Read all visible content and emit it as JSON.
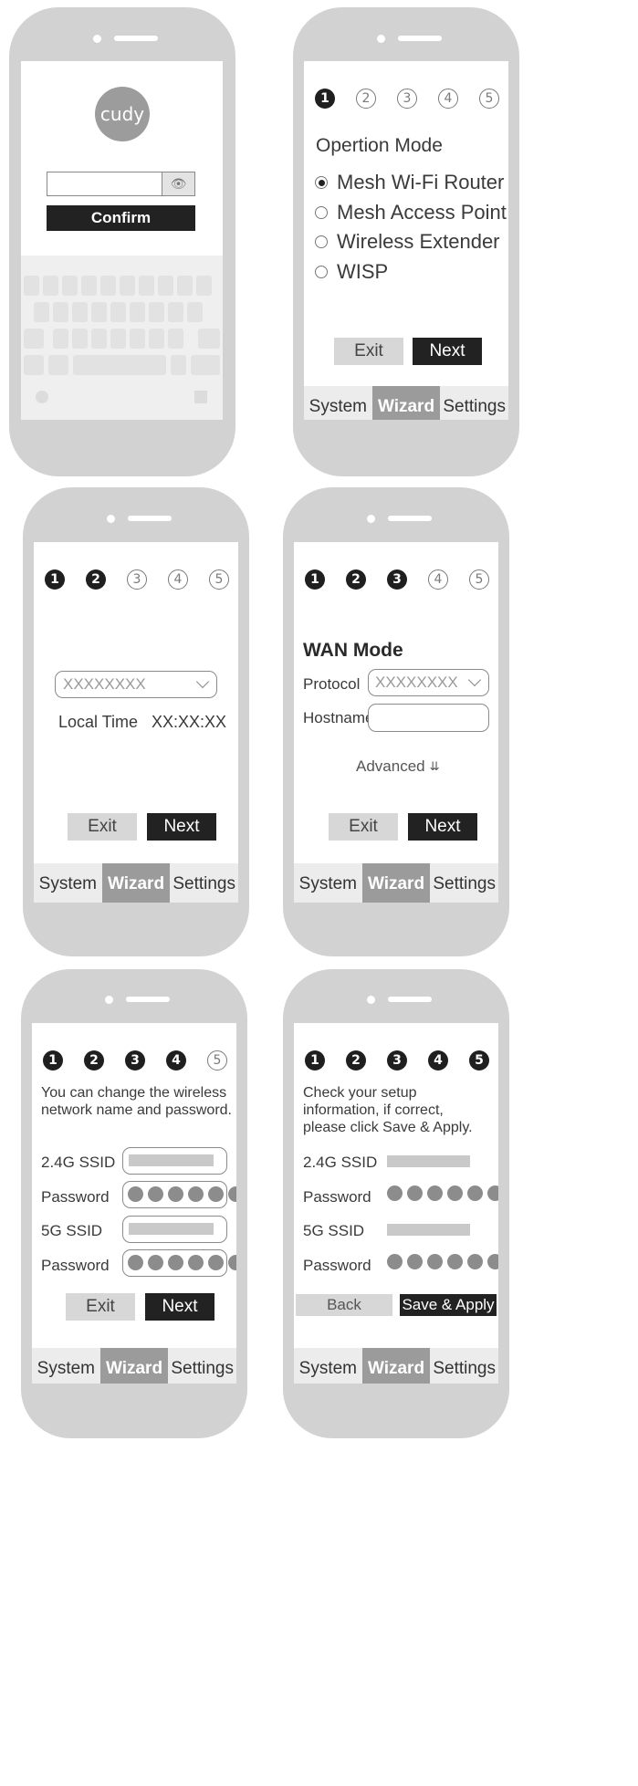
{
  "tabs": {
    "system": "System",
    "wizard": "Wizard",
    "settings": "Settings"
  },
  "buttons": {
    "exit": "Exit",
    "next": "Next",
    "back": "Back",
    "save_apply": "Save & Apply",
    "confirm": "Confirm"
  },
  "login": {
    "logo": "cudy"
  },
  "step1": {
    "steps": [
      "1",
      "2",
      "3",
      "4",
      "5"
    ],
    "title": "Opertion Mode",
    "options": [
      "Mesh Wi-Fi Router",
      "Mesh Access Point",
      "Wireless Extender",
      "WISP"
    ],
    "selected_index": 0
  },
  "step2": {
    "steps": [
      "1",
      "2",
      "3",
      "4",
      "5"
    ],
    "timezone_value": "XXXXXXXX",
    "local_time_label": "Local Time",
    "local_time_value": "XX:XX:XX"
  },
  "step3": {
    "steps": [
      "1",
      "2",
      "3",
      "4",
      "5"
    ],
    "title": "WAN Mode",
    "protocol_label": "Protocol",
    "protocol_value": "XXXXXXXX",
    "hostname_label": "Hostname",
    "advanced_label": "Advanced"
  },
  "step4": {
    "steps": [
      "1",
      "2",
      "3",
      "4",
      "5"
    ],
    "description": "You can change the wireless network name and password.",
    "ssid24_label": "2.4G SSID",
    "password_label": "Password",
    "ssid5_label": "5G SSID"
  },
  "step5": {
    "steps": [
      "1",
      "2",
      "3",
      "4",
      "5"
    ],
    "description": "Check your setup information, if correct, please click Save & Apply.",
    "ssid24_label": "2.4G SSID",
    "password_label": "Password",
    "ssid5_label": "5G SSID"
  },
  "colors": {
    "phone": "#d2d2d2",
    "active_tab": "#9b9b9b",
    "dark_button": "#222222",
    "light_button": "#d7d7d7"
  }
}
